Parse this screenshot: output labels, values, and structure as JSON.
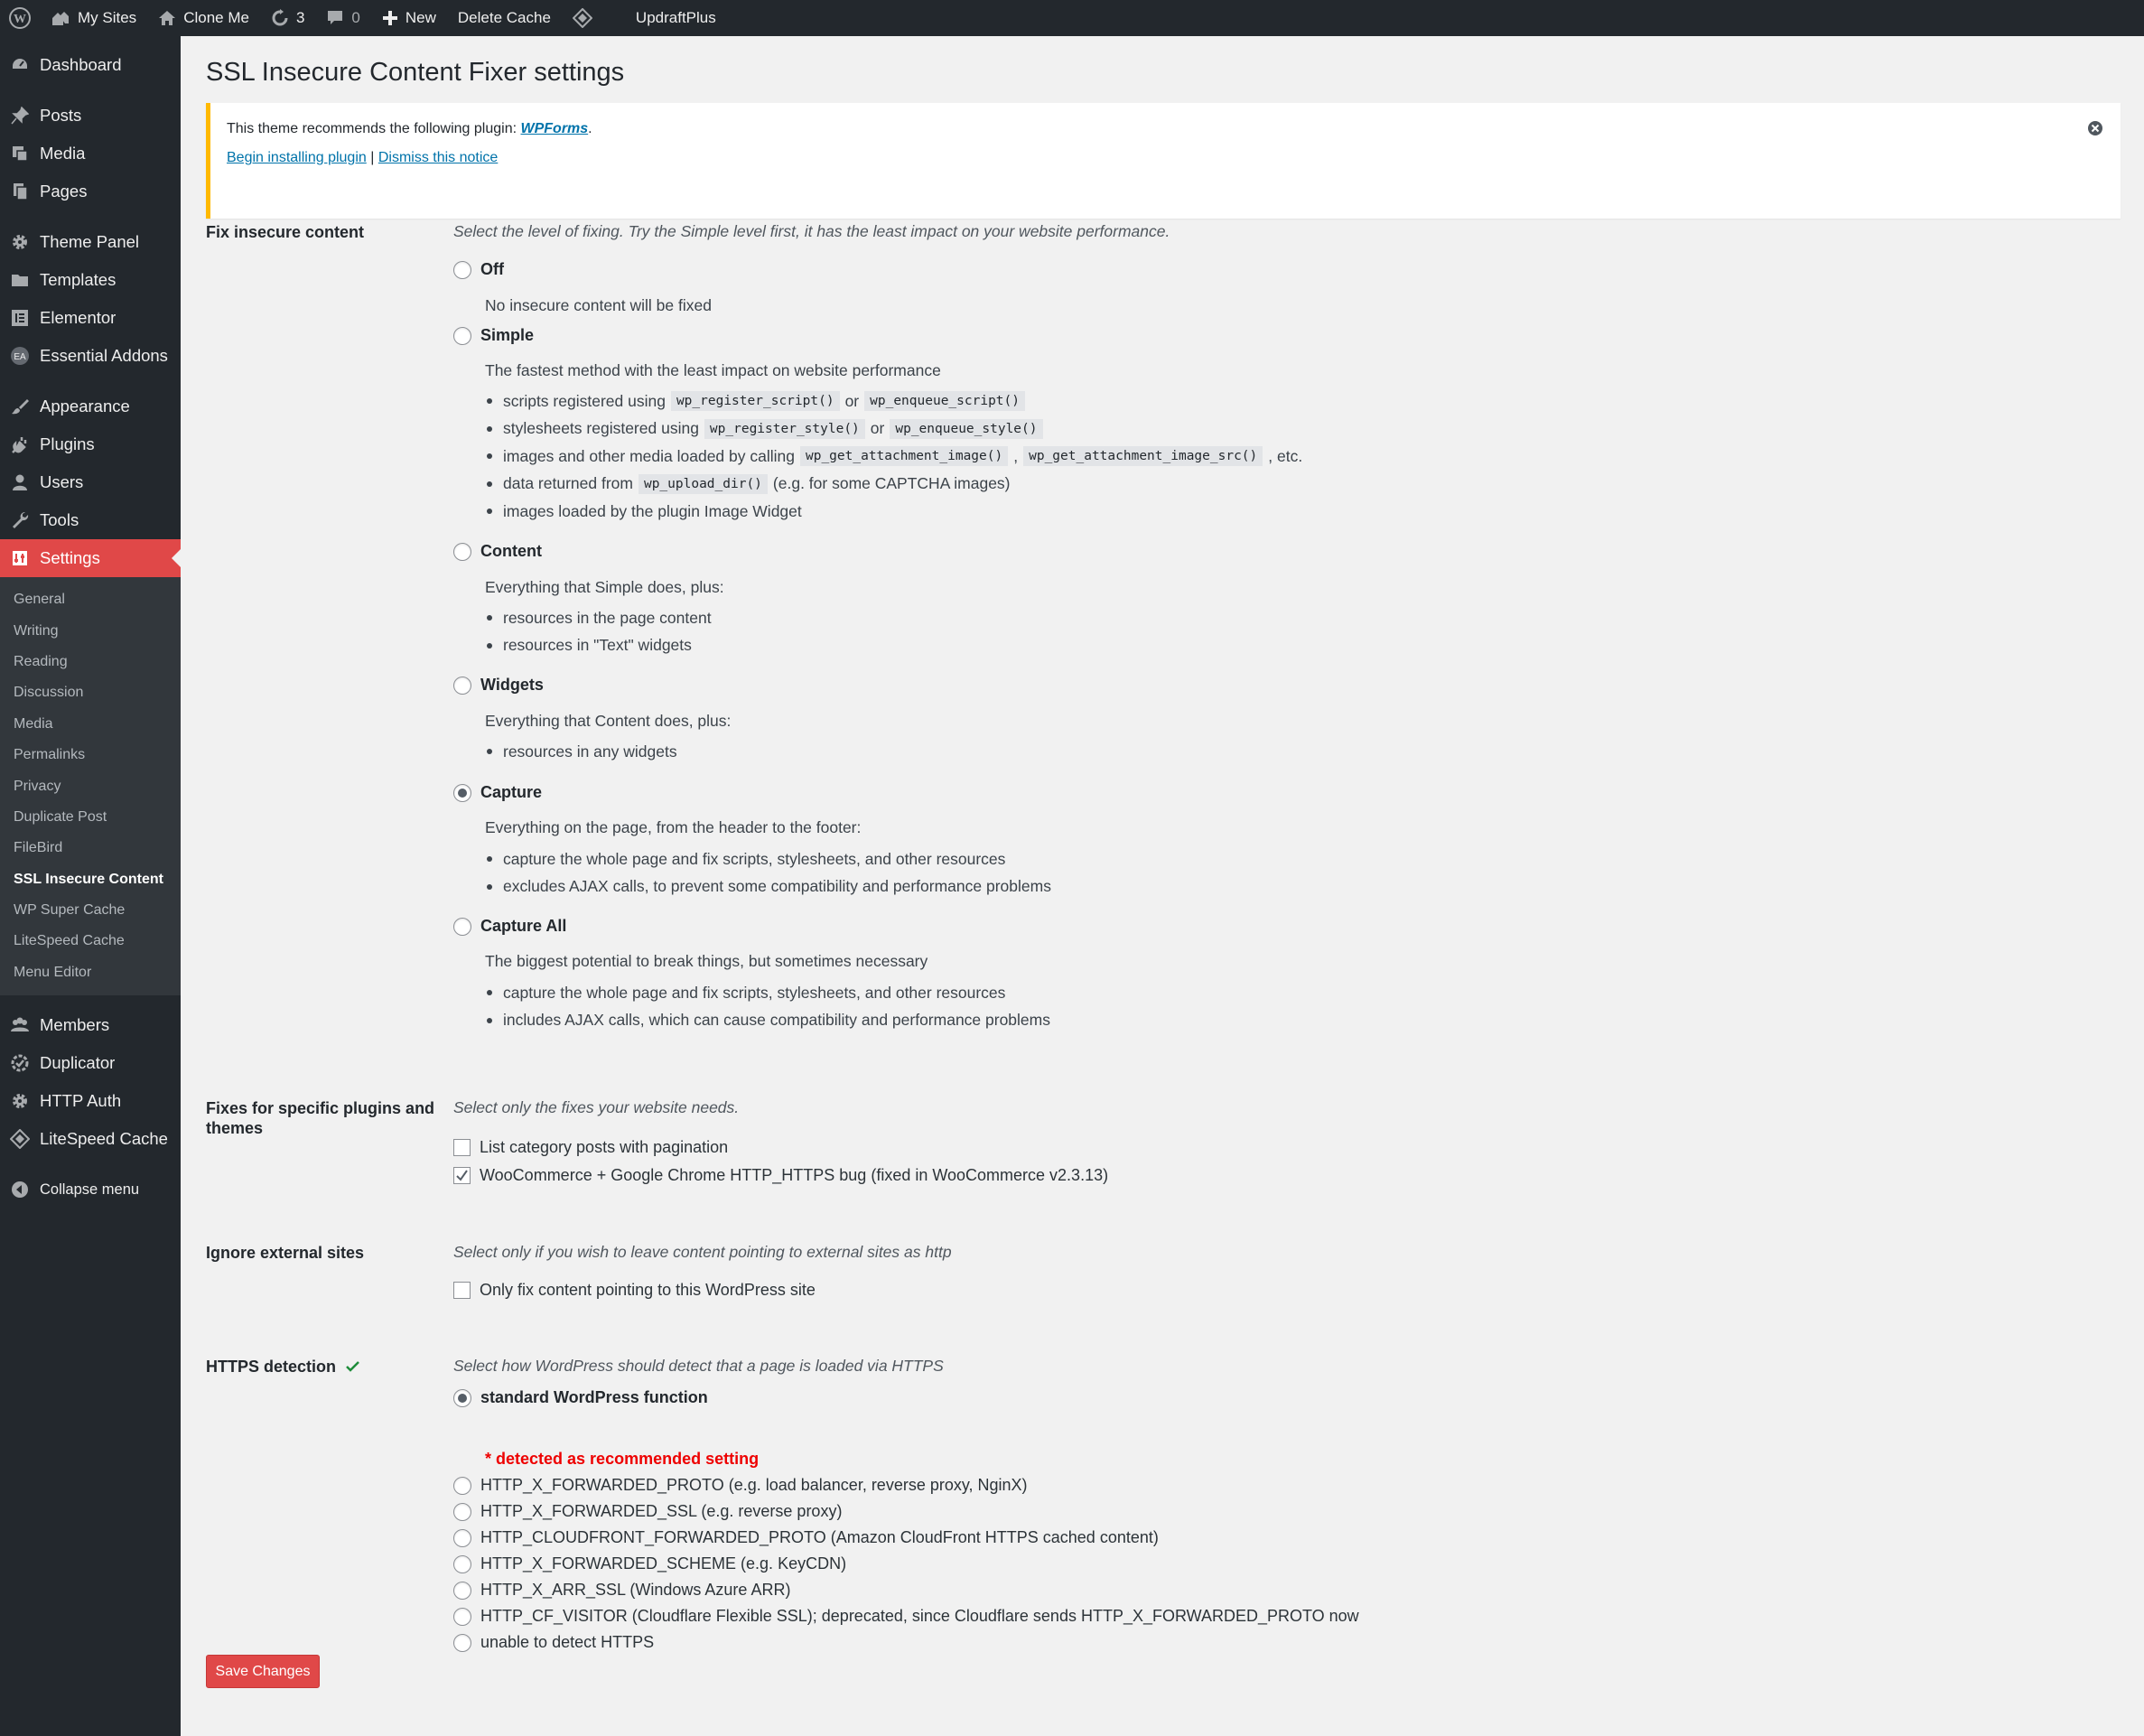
{
  "adminbar": {
    "my_sites": "My Sites",
    "site_name": "Clone Me",
    "updates_count": "3",
    "comments_count": "0",
    "new_label": "New",
    "delete_cache": "Delete Cache",
    "updraft": "UpdraftPlus"
  },
  "sidebar": {
    "group1": [
      {
        "label": "Dashboard",
        "icon": "dashboard-icon"
      }
    ],
    "group2": [
      {
        "label": "Posts",
        "icon": "pin-icon"
      },
      {
        "label": "Media",
        "icon": "media-icon"
      },
      {
        "label": "Pages",
        "icon": "pages-icon"
      }
    ],
    "group3": [
      {
        "label": "Theme Panel",
        "icon": "gear-icon"
      },
      {
        "label": "Templates",
        "icon": "folder-icon"
      },
      {
        "label": "Elementor",
        "icon": "elementor-icon"
      },
      {
        "label": "Essential Addons",
        "icon": "ea-icon"
      }
    ],
    "group4": [
      {
        "label": "Appearance",
        "icon": "brush-icon"
      },
      {
        "label": "Plugins",
        "icon": "plug-icon"
      },
      {
        "label": "Users",
        "icon": "user-icon"
      },
      {
        "label": "Tools",
        "icon": "wrench-icon"
      },
      {
        "label": "Settings",
        "icon": "settings-icon"
      }
    ],
    "settings_sub": [
      "General",
      "Writing",
      "Reading",
      "Discussion",
      "Media",
      "Permalinks",
      "Privacy",
      "Duplicate Post",
      "FileBird",
      "SSL Insecure Content",
      "WP Super Cache",
      "LiteSpeed Cache",
      "Menu Editor"
    ],
    "group5": [
      {
        "label": "Members",
        "icon": "members-icon"
      },
      {
        "label": "Duplicator",
        "icon": "duplicator-icon"
      },
      {
        "label": "HTTP Auth",
        "icon": "gear-icon"
      },
      {
        "label": "LiteSpeed Cache",
        "icon": "diamond-icon"
      }
    ],
    "collapse": "Collapse menu"
  },
  "page": {
    "title": "SSL Insecure Content Fixer settings",
    "notice": {
      "text": "This theme recommends the following plugin: ",
      "plugin": "WPForms",
      "period": ".",
      "install": "Begin installing plugin",
      "sep": " | ",
      "dismiss": "Dismiss this notice"
    },
    "fix": {
      "label": "Fix insecure content",
      "desc": "Select the level of fixing. Try the Simple level first, it has the least impact on your website performance.",
      "off": {
        "label": "Off",
        "desc": "No insecure content will be fixed"
      },
      "simple": {
        "label": "Simple",
        "desc": "The fastest method with the least impact on website performance",
        "b1a": "scripts registered using",
        "b1c1": "wp_register_script()",
        "b1b": "or",
        "b1c2": "wp_enqueue_script()",
        "b2a": "stylesheets registered using",
        "b2c1": "wp_register_style()",
        "b2b": "or",
        "b2c2": "wp_enqueue_style()",
        "b3a": "images and other media loaded by calling",
        "b3c1": "wp_get_attachment_image()",
        "b3b": ",",
        "b3c2": "wp_get_attachment_image_src()",
        "b3d": ", etc.",
        "b4a": "data returned from",
        "b4c1": "wp_upload_dir()",
        "b4b": "(e.g. for some CAPTCHA images)",
        "b5": "images loaded by the plugin Image Widget"
      },
      "content": {
        "label": "Content",
        "desc": "Everything that Simple does, plus:",
        "b1": "resources in the page content",
        "b2": "resources in \"Text\" widgets"
      },
      "widgets": {
        "label": "Widgets",
        "desc": "Everything that Content does, plus:",
        "b1": "resources in any widgets"
      },
      "capture": {
        "label": "Capture",
        "desc": "Everything on the page, from the header to the footer:",
        "b1": "capture the whole page and fix scripts, stylesheets, and other resources",
        "b2": "excludes AJAX calls, to prevent some compatibility and performance problems"
      },
      "capture_all": {
        "label": "Capture All",
        "desc": "The biggest potential to break things, but sometimes necessary",
        "b1": "capture the whole page and fix scripts, stylesheets, and other resources",
        "b2": "includes AJAX calls, which can cause compatibility and performance problems"
      },
      "selected": "Capture"
    },
    "plugins": {
      "label": "Fixes for specific plugins and themes",
      "desc": "Select only the fixes your website needs.",
      "opt1": "List category posts with pagination",
      "opt2": "WooCommerce + Google Chrome HTTP_HTTPS bug (fixed in WooCommerce v2.3.13)"
    },
    "external": {
      "label": "Ignore external sites",
      "desc": "Select only if you wish to leave content pointing to external sites as http",
      "opt1": "Only fix content pointing to this WordPress site"
    },
    "https": {
      "label": "HTTPS detection",
      "desc": "Select how WordPress should detect that a page is loaded via HTTPS",
      "opt_std": "standard WordPress function",
      "recommended": "* detected as recommended setting",
      "options": [
        "HTTP_X_FORWARDED_PROTO (e.g. load balancer, reverse proxy, NginX)",
        "HTTP_X_FORWARDED_SSL (e.g. reverse proxy)",
        "HTTP_CLOUDFRONT_FORWARDED_PROTO (Amazon CloudFront HTTPS cached content)",
        "HTTP_X_FORWARDED_SCHEME (e.g. KeyCDN)",
        "HTTP_X_ARR_SSL (Windows Azure ARR)",
        "HTTP_CF_VISITOR (Cloudflare Flexible SSL); deprecated, since Cloudflare sends HTTP_X_FORWARDED_PROTO now",
        "unable to detect HTTPS"
      ]
    },
    "save": "Save Changes"
  },
  "colors": {
    "accent": "#e04848",
    "sidebar_bg": "#23282d",
    "notice_border": "#ffb900",
    "recommended": "#e00000"
  }
}
